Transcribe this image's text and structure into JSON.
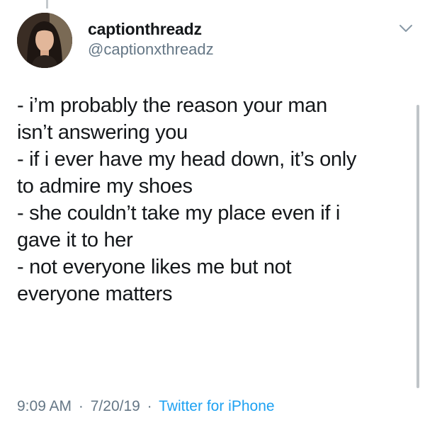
{
  "tweet": {
    "author": {
      "display_name": "captionthreadz",
      "handle": "@captionxthreadz",
      "avatar_icon": "profile-photo"
    },
    "menu_icon": "chevron-down-icon",
    "lines": [
      "- i’m probably the reason your man",
      "isn’t answering you",
      "- if i ever have my head down, it’s only",
      "to admire my shoes",
      "- she couldn’t take my place even if i",
      "gave it to her",
      "- not everyone likes me but not",
      "everyone matters"
    ],
    "time": "9:09 AM",
    "separator": "·",
    "date": "7/20/19",
    "source": "Twitter for iPhone"
  },
  "colors": {
    "text": "#14171a",
    "secondary": "#657786",
    "link": "#1da1f2"
  }
}
